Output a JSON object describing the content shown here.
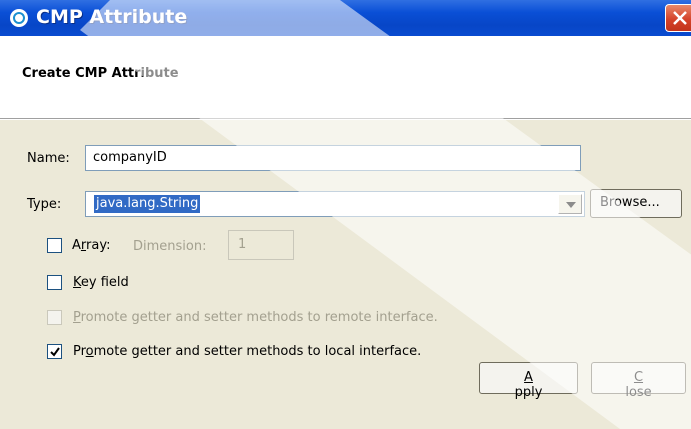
{
  "window": {
    "title": "CMP Attribute",
    "icon": "app-icon",
    "close_icon": "close-icon"
  },
  "header": {
    "title": "Create CMP Attribute"
  },
  "form": {
    "name_label": "Name:",
    "name_value": "companyID",
    "type_label": "Type:",
    "type_value": "java.lang.String",
    "browse_label": "Browse...",
    "array_label_pre": "A",
    "array_label_u": "r",
    "array_label_post": "ray:",
    "array_checked": false,
    "dimension_label": "Dimension:",
    "dimension_value": "1",
    "keyfield_label_u": "K",
    "keyfield_label_post": "ey field",
    "keyfield_checked": false,
    "promote_remote_label_u": "P",
    "promote_remote_label_post": "romote getter and setter methods to remote interface.",
    "promote_remote_checked": false,
    "promote_remote_enabled": false,
    "promote_local_label_pre": "Pr",
    "promote_local_label_u": "o",
    "promote_local_label_post": "mote getter and setter methods to local interface.",
    "promote_local_checked": true
  },
  "buttons": {
    "apply_u": "A",
    "apply_post": "pply",
    "close_u": "C",
    "close_post": "lose"
  },
  "colors": {
    "titlebar": "#0a4fd6",
    "dialog_bg": "#ece9d8",
    "selection": "#316ac5",
    "close_button": "#d5432a"
  }
}
